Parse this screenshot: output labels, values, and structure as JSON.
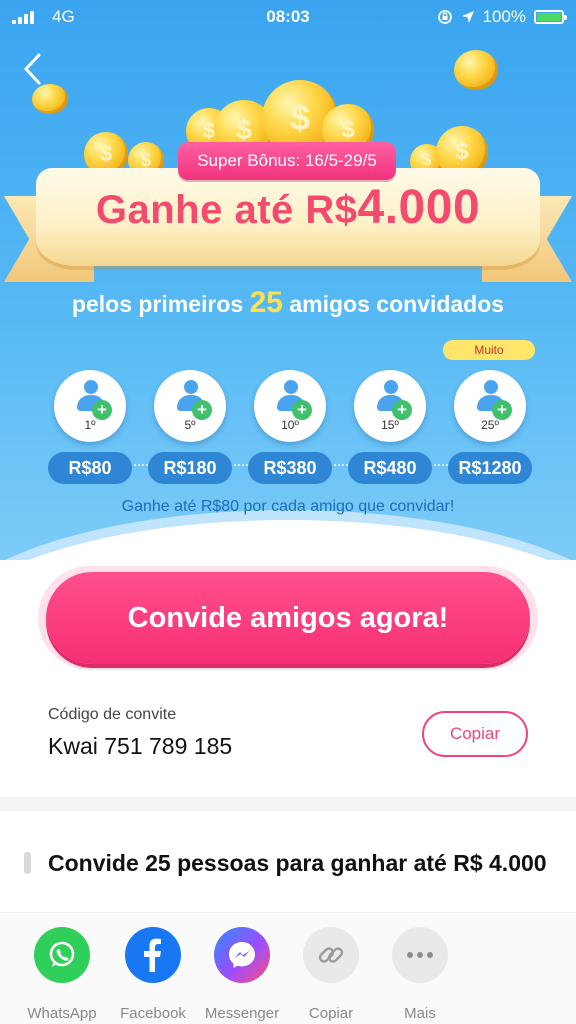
{
  "status_bar": {
    "network": "4G",
    "time": "08:03",
    "battery": "100%",
    "battery_level": 1.0
  },
  "hero": {
    "bonus_label": "Super Bônus: 16/5-29/5",
    "title_prefix": "Ganhe até R$",
    "title_amount": "4.000",
    "subtitle_before": "pelos primeiros",
    "subtitle_number": "25",
    "subtitle_after": "amigos convidados",
    "muito_badge": "Muito",
    "tiers": [
      {
        "rank": "1º",
        "amount": "R$80"
      },
      {
        "rank": "5º",
        "amount": "R$180"
      },
      {
        "rank": "10º",
        "amount": "R$380"
      },
      {
        "rank": "15º",
        "amount": "R$480"
      },
      {
        "rank": "25º",
        "amount": "R$1280"
      }
    ],
    "earn_line": "Ganhe até R$80 por cada amigo que convidar!"
  },
  "cta": {
    "label": "Convide amigos agora!"
  },
  "invite": {
    "label": "Código de convite",
    "code": "Kwai 751 789 185",
    "copy_label": "Copiar"
  },
  "section": {
    "title": "Convide 25 pessoas para ganhar até R$ 4.000"
  },
  "share": {
    "items": [
      {
        "label": "WhatsApp",
        "icon": "whatsapp-icon",
        "color": "#2fcf5a"
      },
      {
        "label": "Facebook",
        "icon": "facebook-icon",
        "color": "#1877f2"
      },
      {
        "label": "Messenger",
        "icon": "messenger-icon",
        "color": "#9b4dff"
      },
      {
        "label": "Copiar",
        "icon": "link-icon",
        "color": "#e9e9e9"
      },
      {
        "label": "Mais",
        "icon": "more-icon",
        "color": "#e9e9e9"
      }
    ]
  },
  "colors": {
    "hero_blue": "#3aa4f0",
    "accent_pink": "#f72f74",
    "title_pink": "#f24b6e",
    "tier_blue": "#2e86d4"
  }
}
